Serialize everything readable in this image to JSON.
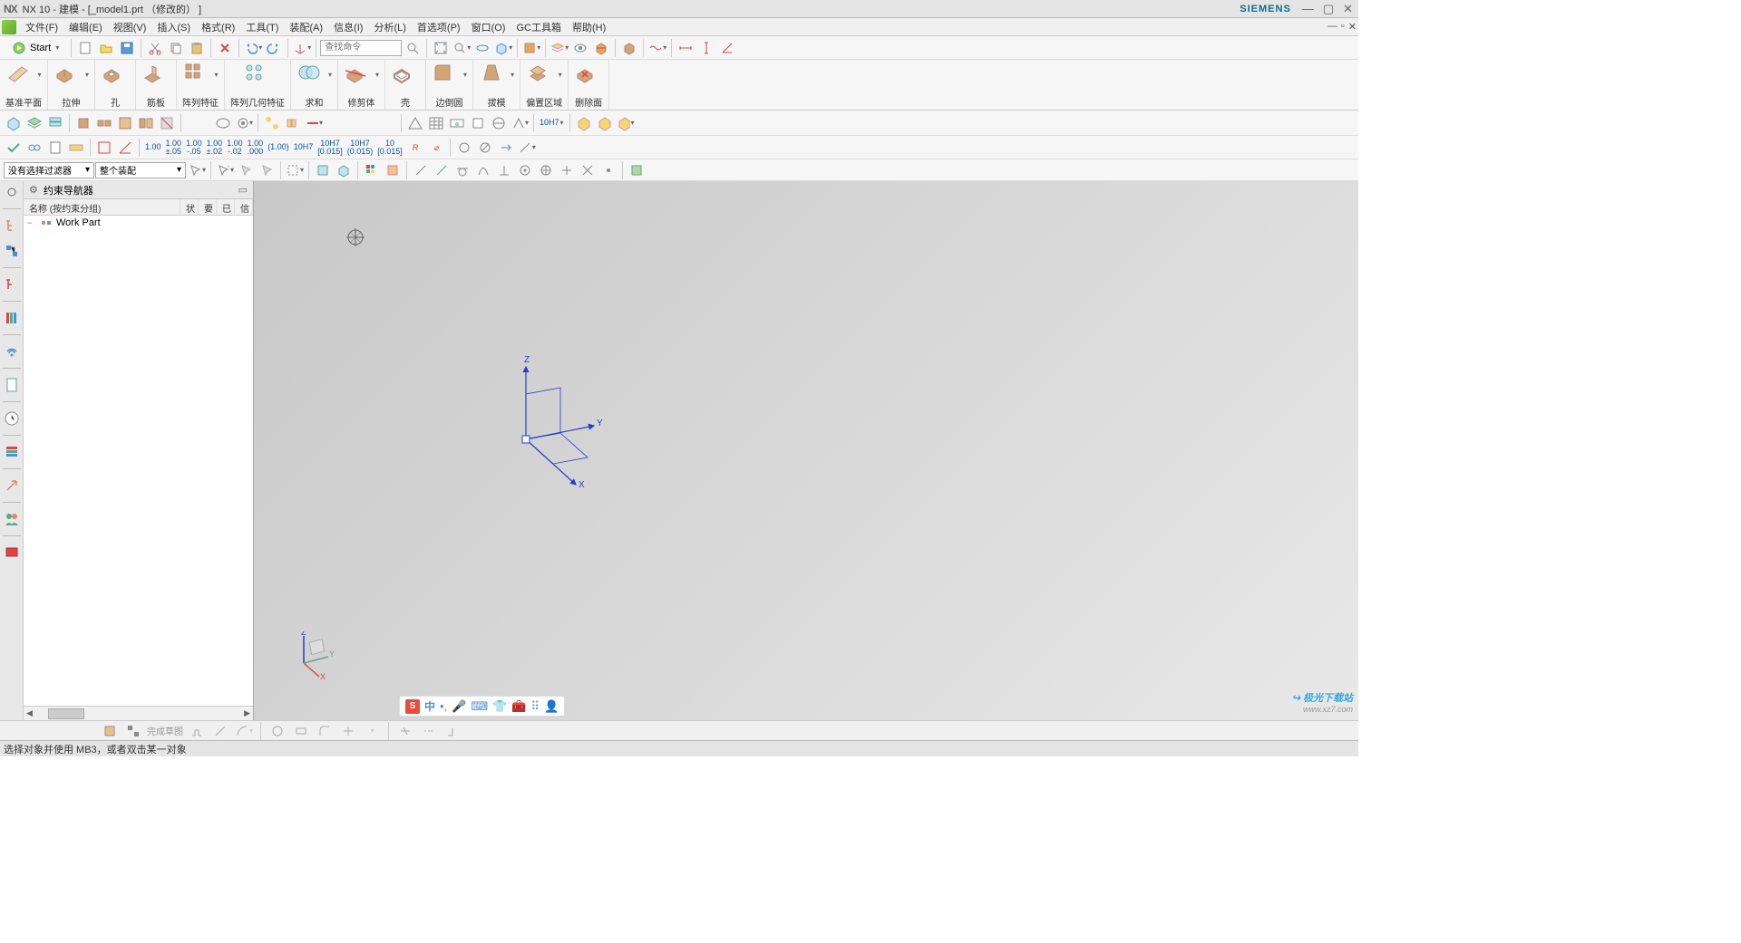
{
  "titlebar": {
    "logo": "NX",
    "title": "NX 10 - 建模 - [_model1.prt （修改的） ]",
    "brand": "SIEMENS"
  },
  "menubar": {
    "items": [
      "文件(F)",
      "编辑(E)",
      "视图(V)",
      "插入(S)",
      "格式(R)",
      "工具(T)",
      "装配(A)",
      "信息(I)",
      "分析(L)",
      "首选项(P)",
      "窗口(O)",
      "GC工具箱",
      "帮助(H)"
    ]
  },
  "toolbar1": {
    "start_label": "Start",
    "search_placeholder": "查找命令"
  },
  "ribbon": {
    "groups": [
      {
        "label": "基准平面"
      },
      {
        "label": "拉伸"
      },
      {
        "label": "孔"
      },
      {
        "label": "筋板"
      },
      {
        "label": "阵列特征"
      },
      {
        "label": "阵列几何特征"
      },
      {
        "label": "求和"
      },
      {
        "label": "修剪体"
      },
      {
        "label": "壳"
      },
      {
        "label": "边倒圆"
      },
      {
        "label": "拔模"
      },
      {
        "label": "偏置区域"
      },
      {
        "label": "删除面"
      }
    ]
  },
  "dim_labels": [
    "1.00",
    "1.00\n±.05",
    "1.00\n-.05",
    "1.00\n±.02",
    "1.00\n-.02",
    "1.00\n.000",
    "(1.00)",
    "10H7",
    "10H7\n[0.015]",
    "10H7\n(0.015)",
    "10\n[0.015]"
  ],
  "selectors": {
    "filter": "没有选择过滤器",
    "assembly": "整个装配"
  },
  "nav": {
    "title": "约束导航器",
    "columns": {
      "name": "名称 (按约束分组)",
      "c2": "状",
      "c3": "要",
      "c4": "已",
      "c5": "信"
    },
    "tree": {
      "root": "Work Part"
    }
  },
  "csys": {
    "x": "X",
    "y": "Y",
    "z": "Z"
  },
  "triad": {
    "x": "X",
    "y": "Y",
    "z": "Z"
  },
  "bottom": {
    "sketch_label": "完成草图"
  },
  "status": {
    "text": "选择对象并使用 MB3，或者双击某一对象"
  },
  "ime": {
    "lang": "中",
    "logo": "S"
  },
  "watermark": {
    "line1": "极光下载站",
    "line2": "www.xz7.com"
  }
}
